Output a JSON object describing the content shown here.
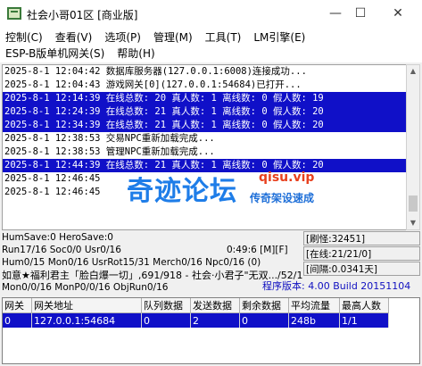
{
  "window": {
    "title": "社会小哥01区 [商业版]",
    "min": "—",
    "max": "☐",
    "close": "✕"
  },
  "menu": {
    "row1": [
      "控制(C)",
      "查看(V)",
      "选项(P)",
      "管理(M)",
      "工具(T)",
      "LM引擎(E)"
    ],
    "row2": [
      "ESP-B版单机网关(S)",
      "帮助(H)"
    ]
  },
  "log": [
    {
      "text": "2025-8-1 12:04:42 数据库服务器(127.0.0.1:6008)连接成功...",
      "highlight": false
    },
    {
      "text": "2025-8-1 12:04:43 游戏网关[0](127.0.0.1:54684)已打开...",
      "highlight": false
    },
    {
      "text": "2025-8-1 12:14:39 在线总数: 20 真人数: 1 离线数: 0 假人数: 19",
      "highlight": true
    },
    {
      "text": "2025-8-1 12:24:39 在线总数: 21 真人数: 1 离线数: 0 假人数: 20",
      "highlight": true
    },
    {
      "text": "2025-8-1 12:34:39 在线总数: 21 真人数: 1 离线数: 0 假人数: 20",
      "highlight": true
    },
    {
      "text": "2025-8-1 12:38:53 交易NPC重新加载完成...",
      "highlight": false
    },
    {
      "text": "2025-8-1 12:38:53 管理NPC重新加载完成...",
      "highlight": false
    },
    {
      "text": "2025-8-1 12:44:39 在线总数: 21 真人数: 1 离线数: 0 假人数: 20",
      "highlight": true
    },
    {
      "text": "2025-8-1 12:46:45",
      "highlight": false
    },
    {
      "text": "2025-8-1 12:46:45",
      "highlight": false
    },
    {
      "text": "",
      "highlight": false
    },
    {
      "text": "",
      "highlight": false
    }
  ],
  "watermark": {
    "big": "奇迹论坛",
    "url": "qisu.vip",
    "sub": "传奇架设速成"
  },
  "status": {
    "line1": "HumSave:0 HeroSave:0",
    "line2": "Run17/16 Soc0/0 Usr0/16",
    "time": "0:49:6 [M][F]",
    "line3": "Hum0/15 Mon0/16 UsrRot15/31 Merch0/16 Npc0/16 (0)",
    "line4": "如意★福利君主「脸白爆一切」,691/918 - 社会·小君子\"无双.../52/1",
    "line5": "Mon0/0/16 MonP0/0/16 ObjRun0/16",
    "refresh": "[刷怪:32451]",
    "online": "[在线:21/21/0]",
    "interval": "[间隔:0.0341天]",
    "version": "程序版本: 4.00 Build 20151104"
  },
  "grid": {
    "headers": [
      "网关",
      "网关地址",
      "队列数据",
      "发送数据",
      "剩余数据",
      "平均流量",
      "最高人数"
    ],
    "rows": [
      [
        "0",
        "127.0.0.1:54684",
        "0",
        "2",
        "0",
        "248b",
        "1/1"
      ]
    ]
  },
  "colors": {
    "highlight": "#1010c8",
    "watermark_blue": "#1e7de8",
    "watermark_red": "#e8401e"
  }
}
